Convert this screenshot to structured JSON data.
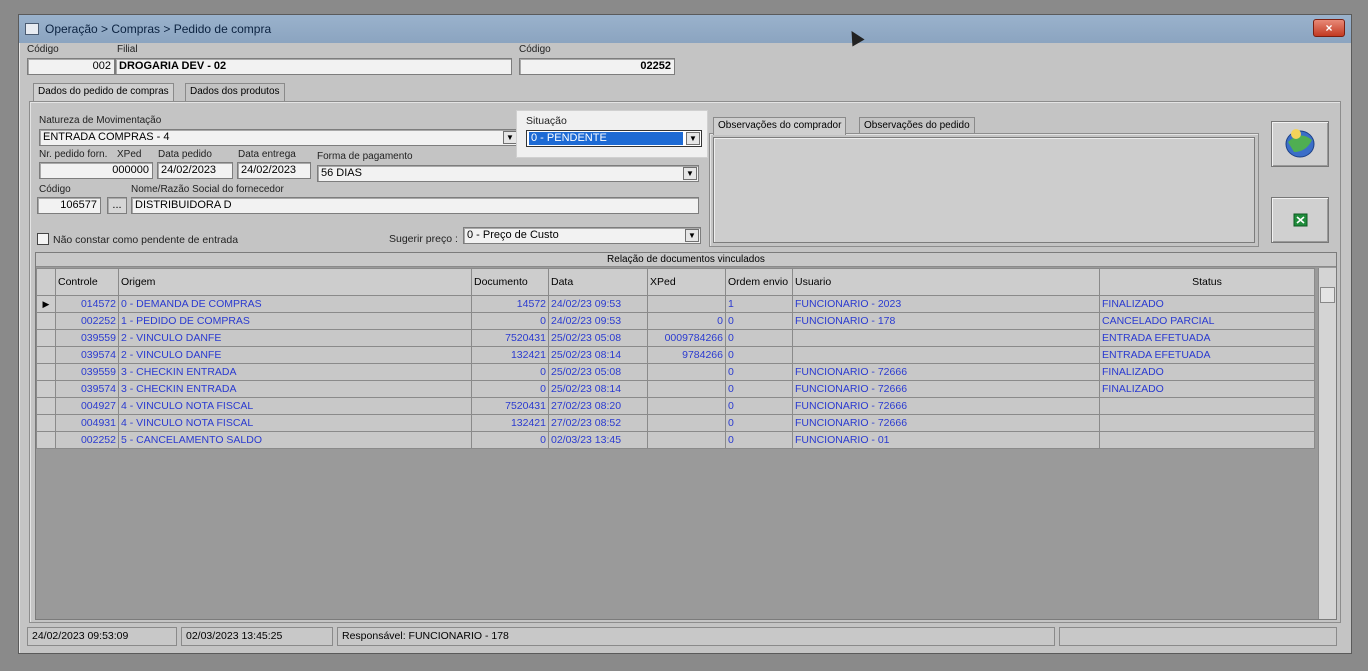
{
  "window": {
    "title": "Operação > Compras > Pedido de compra",
    "close_label": "×"
  },
  "header": {
    "codigo_label": "Código",
    "codigo_value": "002",
    "filial_label": "Filial",
    "filial_value": "DROGARIA DEV - 02",
    "codigo2_label": "Código",
    "codigo2_value": "02252"
  },
  "tabs": [
    "Dados do pedido de compras",
    "Dados dos produtos"
  ],
  "form": {
    "natureza_label": "Natureza de Movimentação",
    "natureza_value": "ENTRADA COMPRAS - 4",
    "situacao_label": "Situação",
    "situacao_value": "0 - PENDENTE",
    "nr_pedido_label": "Nr. pedido forn.",
    "nr_pedido_value": "000000",
    "xped_label": "XPed",
    "data_pedido_label": "Data pedido",
    "data_pedido_value": "24/02/2023",
    "data_entrega_label": "Data entrega",
    "data_entrega_value": "24/02/2023",
    "forma_pag_label": "Forma de pagamento",
    "forma_pag_value": "56 DIAS",
    "codigo_forn_label": "Código",
    "codigo_forn_value": "106577",
    "lookup_label": "...",
    "nome_label": "Nome/Razão Social do fornecedor",
    "nome_value": "DISTRIBUIDORA D",
    "nao_constar_label": "Não constar como pendente de entrada",
    "sugerir_label": "Sugerir preço :",
    "sugerir_value": "0 - Preço de Custo"
  },
  "obs_tabs": [
    "Observações do comprador",
    "Observações do pedido"
  ],
  "grid": {
    "caption": "Relação de documentos vinculados",
    "columns": [
      "Controle",
      "Origem",
      "Documento",
      "Data",
      "XPed",
      "Ordem envio",
      "Usuario",
      "Status"
    ],
    "rows": [
      [
        "014572",
        "0 - DEMANDA DE COMPRAS",
        "14572",
        "24/02/23 09:53",
        "",
        "1",
        "FUNCIONARIO - 2023",
        "FINALIZADO"
      ],
      [
        "002252",
        "1 - PEDIDO DE COMPRAS",
        "0",
        "24/02/23 09:53",
        "0",
        "0",
        "FUNCIONARIO - 178",
        "CANCELADO PARCIAL"
      ],
      [
        "039559",
        "2 - VINCULO DANFE",
        "7520431",
        "25/02/23 05:08",
        "0009784266",
        "0",
        "",
        "ENTRADA EFETUADA"
      ],
      [
        "039574",
        "2 - VINCULO DANFE",
        "132421",
        "25/02/23 08:14",
        "9784266",
        "0",
        "",
        "ENTRADA EFETUADA"
      ],
      [
        "039559",
        "3 - CHECKIN ENTRADA",
        "0",
        "25/02/23 05:08",
        "",
        "0",
        "FUNCIONARIO - 72666",
        "FINALIZADO"
      ],
      [
        "039574",
        "3 - CHECKIN ENTRADA",
        "0",
        "25/02/23 08:14",
        "",
        "0",
        "FUNCIONARIO - 72666",
        "FINALIZADO"
      ],
      [
        "004927",
        "4 - VINCULO NOTA FISCAL",
        "7520431",
        "27/02/23 08:20",
        "",
        "0",
        "FUNCIONARIO - 72666",
        ""
      ],
      [
        "004931",
        "4 - VINCULO NOTA FISCAL",
        "132421",
        "27/02/23 08:52",
        "",
        "0",
        "FUNCIONARIO - 72666",
        ""
      ],
      [
        "002252",
        "5 - CANCELAMENTO SALDO",
        "0",
        "02/03/23 13:45",
        "",
        "0",
        "FUNCIONARIO - 01",
        ""
      ]
    ]
  },
  "status": {
    "created": "24/02/2023 09:53:09",
    "updated": "02/03/2023 13:45:25",
    "responsavel": "Responsável: FUNCIONARIO - 178"
  },
  "icons": {
    "combo_arrow": "▼",
    "row_pointer": "▶",
    "side_button_1": "web-globe-icon",
    "side_button_2": "excel-icon"
  },
  "colors": {
    "grid_text": "#2a3ad0",
    "selection": "#1d6ad4",
    "titlebar": "#8ba4c0"
  }
}
